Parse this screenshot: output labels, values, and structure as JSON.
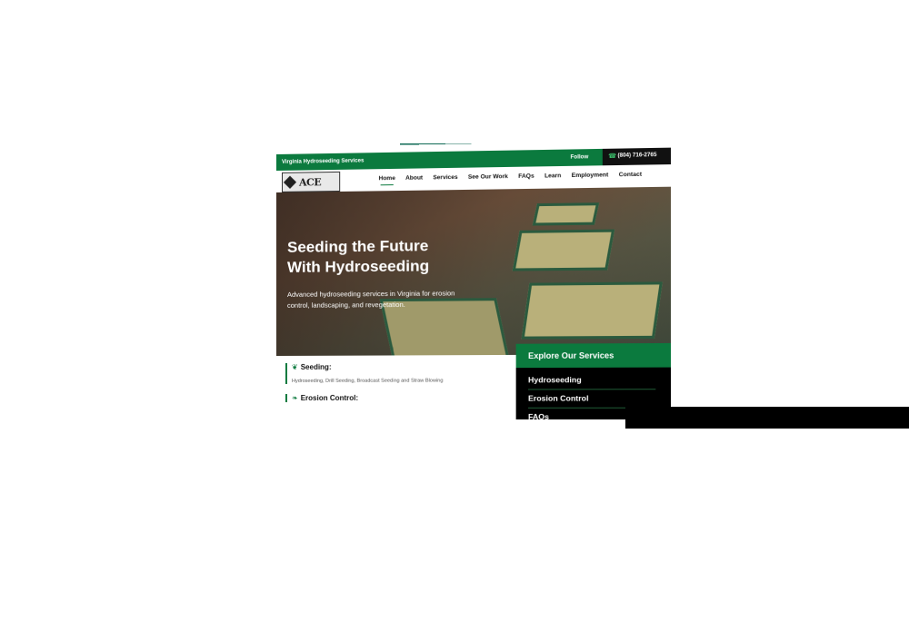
{
  "topbar": {
    "tagline": "Virginia Hydroseeding Services",
    "follow_label": "Follow",
    "phone": "(804) 716-2765",
    "phone_icon": "phone-icon"
  },
  "brand": {
    "logo_text": "ACE",
    "accent_color": "#0b7a3e"
  },
  "nav": {
    "items": [
      {
        "label": "Home",
        "active": true
      },
      {
        "label": "About"
      },
      {
        "label": "Services"
      },
      {
        "label": "See Our Work"
      },
      {
        "label": "FAQs"
      },
      {
        "label": "Learn"
      },
      {
        "label": "Employment"
      },
      {
        "label": "Contact"
      }
    ]
  },
  "hero": {
    "title_line1": "Seeding the Future",
    "title_line2": "With Hydroseeding",
    "subtitle": "Advanced hydroseeding services in Virginia for erosion control, landscaping, and revegetation."
  },
  "features": [
    {
      "title": "Seeding:",
      "icon": "sprout-icon",
      "description": "Hydroseeding, Drill Seeding, Broadcast Seeding and Straw Blowing"
    },
    {
      "title": "Erosion Control:",
      "icon": "leaf-icon"
    }
  ],
  "services_panel": {
    "heading": "Explore Our Services",
    "items": [
      "Hydroseeding",
      "Erosion Control",
      "FAQs"
    ]
  }
}
